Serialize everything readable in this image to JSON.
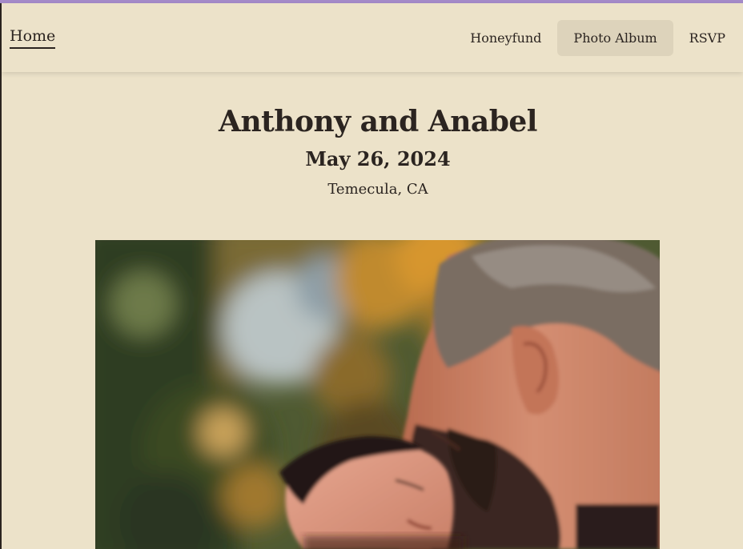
{
  "nav": {
    "home_label": "Home",
    "links": [
      {
        "label": "Honeyfund"
      },
      {
        "label": "Photo Album",
        "active": true
      },
      {
        "label": "RSVP"
      }
    ]
  },
  "header": {
    "couple": "Anthony and Anabel",
    "date": "May 26, 2024",
    "location": "Temecula, CA"
  },
  "colors": {
    "background": "#ece2c9",
    "accent_bar": "#a58bc9",
    "text": "#2b2420",
    "active_tab": "#ddd3bb"
  }
}
